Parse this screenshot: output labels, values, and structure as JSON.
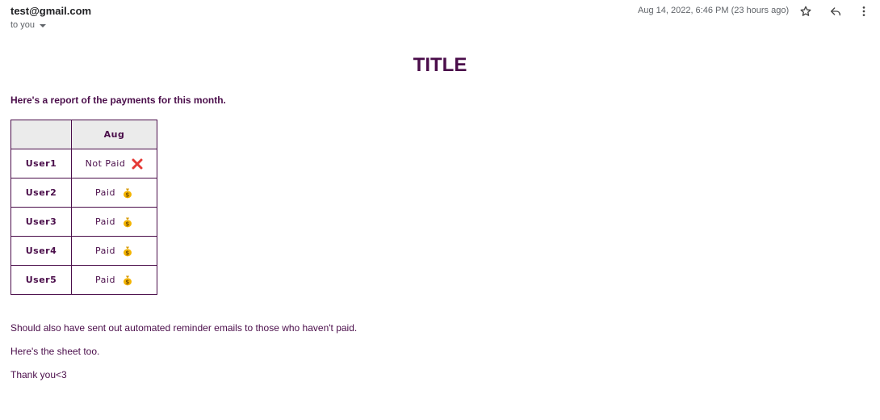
{
  "header": {
    "sender": "test@gmail.com",
    "recipient": "to you",
    "timestamp": "Aug 14, 2022, 6:46 PM (23 hours ago)",
    "icons": [
      "star-icon",
      "reply-icon",
      "more-vert-icon"
    ]
  },
  "email": {
    "title": "TITLE",
    "intro": "Here's a report of the payments for this month.",
    "table": {
      "month_header": "Aug",
      "rows": [
        {
          "user": "User1",
          "status": "Not Paid",
          "icon": "cross-mark-icon"
        },
        {
          "user": "User2",
          "status": "Paid",
          "icon": "money-bag-icon"
        },
        {
          "user": "User3",
          "status": "Paid",
          "icon": "money-bag-icon"
        },
        {
          "user": "User4",
          "status": "Paid",
          "icon": "money-bag-icon"
        },
        {
          "user": "User5",
          "status": "Paid",
          "icon": "money-bag-icon"
        }
      ]
    },
    "paragraphs": [
      "Should also have sent out automated reminder emails to those who haven't paid.",
      "Here's the sheet too.",
      "Thank you<3"
    ]
  },
  "colors": {
    "text_accent": "#4a0d4a",
    "header_bg": "#ebebeb",
    "cross_red": "#e53935",
    "money_gold": "#f4b400"
  }
}
